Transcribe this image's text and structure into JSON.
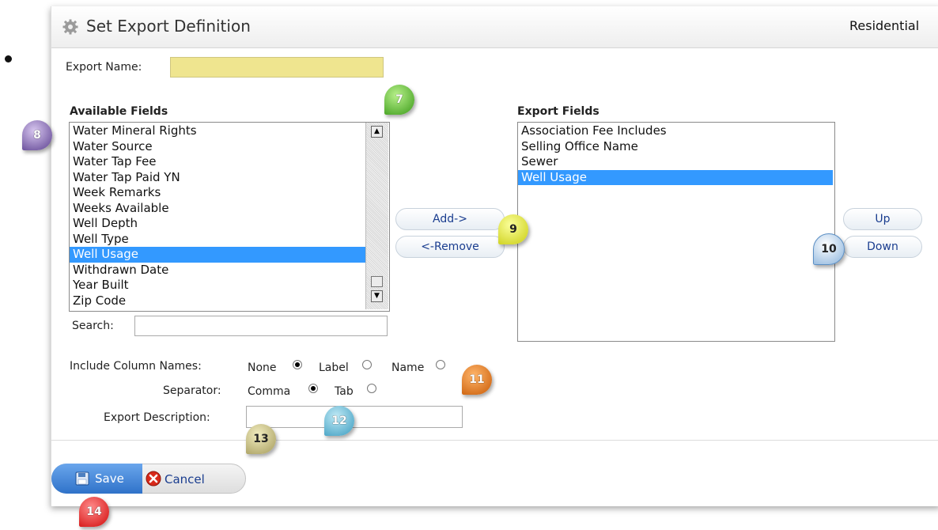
{
  "dialog": {
    "title": "Set Export Definition",
    "title_right": "Residential",
    "title_icon": "gear-icon"
  },
  "export_name": {
    "label": "Export Name:",
    "value": ""
  },
  "available_fields": {
    "heading": "Available Fields",
    "items": [
      "Water Mineral Rights",
      "Water Source",
      "Water Tap Fee",
      "Water Tap Paid YN",
      "Week Remarks",
      "Weeks Available",
      "Well Depth",
      "Well Type",
      "Well Usage",
      "Withdrawn Date",
      "Year Built",
      "Zip Code"
    ],
    "selected": "Well Usage"
  },
  "export_fields": {
    "heading": "Export Fields",
    "items": [
      "Association Fee Includes",
      "Selling Office Name",
      "Sewer",
      "Well Usage"
    ],
    "selected": "Well Usage"
  },
  "search": {
    "label": "Search:",
    "value": ""
  },
  "buttons": {
    "add": "Add->",
    "remove": "<-Remove",
    "up": "Up",
    "down": "Down",
    "save": "Save",
    "cancel": "Cancel"
  },
  "include_column_names": {
    "label": "Include Column Names:",
    "options": [
      "None",
      "Label",
      "Name"
    ],
    "selected": "None"
  },
  "separator": {
    "label": "Separator:",
    "options": [
      "Comma",
      "Tab"
    ],
    "selected": "Comma"
  },
  "export_description": {
    "label": "Export Description:",
    "value": ""
  },
  "callouts": [
    "7",
    "8",
    "9",
    "10",
    "11",
    "12",
    "13",
    "14"
  ],
  "colors": {
    "selection": "#3399ff",
    "name_field": "#efe58f",
    "save_button": "#2f72c9"
  }
}
